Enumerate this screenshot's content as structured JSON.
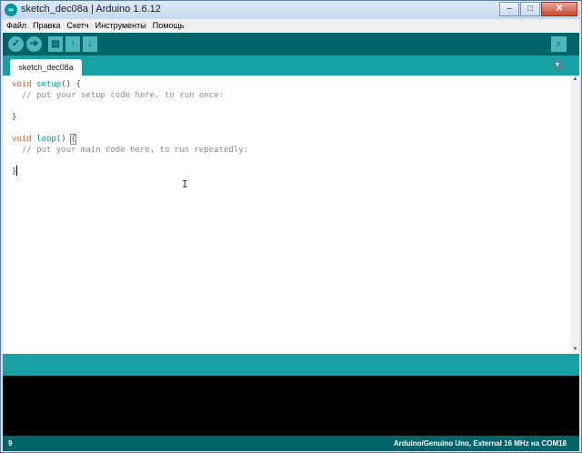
{
  "window": {
    "title": "sketch_dec08a | Arduino 1.6.12",
    "app_icon": "arduino-logo-icon",
    "controls": [
      "minimize-icon",
      "maximize-icon",
      "close-icon"
    ]
  },
  "menu": {
    "items": [
      "Файл",
      "Правка",
      "Скетч",
      "Инструменты",
      "Помощь"
    ]
  },
  "toolbar": {
    "buttons": [
      {
        "name": "verify",
        "icon": "checkmark-icon"
      },
      {
        "name": "upload",
        "icon": "arrow-right-icon"
      },
      {
        "name": "new",
        "icon": "new-document-icon"
      },
      {
        "name": "open",
        "icon": "arrow-up-icon"
      },
      {
        "name": "save",
        "icon": "arrow-down-icon"
      }
    ],
    "serial_monitor_icon": "magnifier-icon"
  },
  "tabs": {
    "active": "sketch_dec08a",
    "menu_icon": "triangle-down-icon"
  },
  "editor": {
    "lines": [
      "void setup() {",
      "  // put your setup code here, to run once:",
      "",
      "}",
      "",
      "void loop() {",
      "  // put your main code here, to run repeatedly:",
      "",
      "}"
    ]
  },
  "status": {
    "line_number": "9",
    "board": "Arduino/Genuino Uno, External 16 MHz на COM18"
  },
  "colors": {
    "toolbar": "#006468",
    "tab_strip": "#17a1a5",
    "console": "#000000",
    "keyword": "#cc6633",
    "function": "#00979c"
  }
}
